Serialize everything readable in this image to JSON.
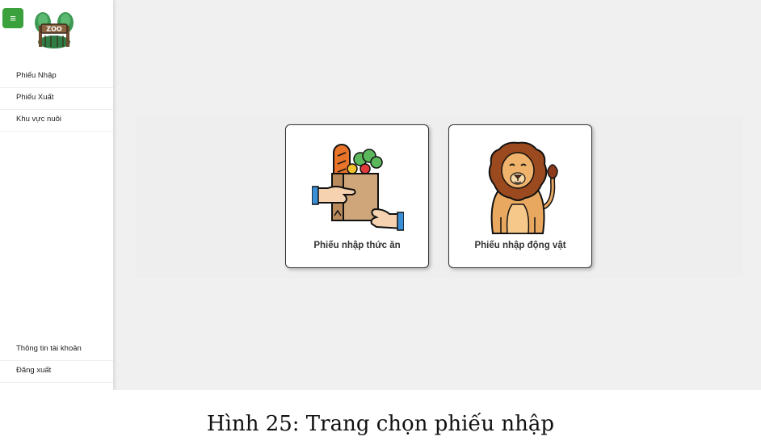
{
  "sidebar": {
    "menu_toggle": "≡",
    "logo_text": "ZOO",
    "nav_items": [
      {
        "label": "Phiếu Nhập"
      },
      {
        "label": "Phiếu Xuất"
      },
      {
        "label": "Khu vực nuôi"
      }
    ],
    "bottom_items": [
      {
        "label": "Thông tin tài khoản"
      },
      {
        "label": "Đăng xuất"
      }
    ]
  },
  "cards": [
    {
      "label": "Phiếu nhập thức ăn",
      "icon": "food-bag-icon"
    },
    {
      "label": "Phiếu nhập động vật",
      "icon": "lion-icon"
    }
  ],
  "caption": "Hình 25: Trang chọn phiếu nhập",
  "colors": {
    "accent": "#3aa13d",
    "page_bg": "#f0f0f1"
  }
}
